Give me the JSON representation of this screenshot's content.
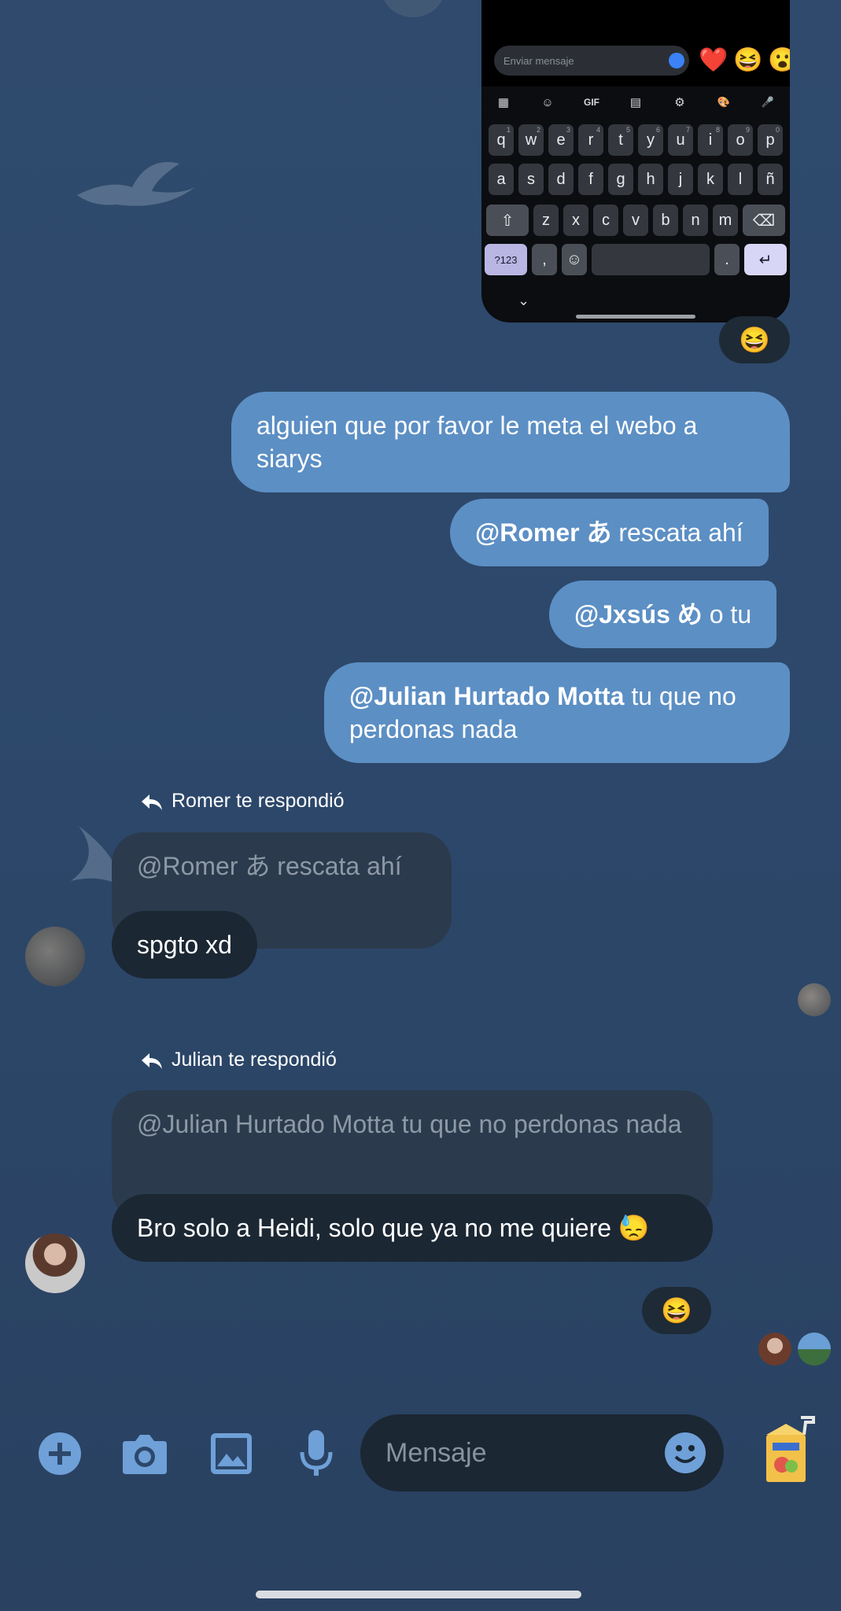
{
  "keyboard_screenshot": {
    "input_placeholder": "Enviar mensaje",
    "emojis": [
      "❤️",
      "😆",
      "😮"
    ],
    "tools": [
      "▦",
      "☺",
      "GIF",
      "▤",
      "⚙",
      "🎨",
      "🎤"
    ],
    "row1": [
      [
        "q",
        "1"
      ],
      [
        "w",
        "2"
      ],
      [
        "e",
        "3"
      ],
      [
        "r",
        "4"
      ],
      [
        "t",
        "5"
      ],
      [
        "y",
        "6"
      ],
      [
        "u",
        "7"
      ],
      [
        "i",
        "8"
      ],
      [
        "o",
        "9"
      ],
      [
        "p",
        "0"
      ]
    ],
    "row2": [
      "a",
      "s",
      "d",
      "f",
      "g",
      "h",
      "j",
      "k",
      "l",
      "ñ"
    ],
    "row3": [
      "z",
      "x",
      "c",
      "v",
      "b",
      "n",
      "m"
    ],
    "shift": "⇧",
    "backspace": "⌫",
    "num_key": "?123",
    "comma": ",",
    "emoji_key": "☺",
    "period": ".",
    "enter": "↵",
    "chevron": "⌄"
  },
  "reaction_top": "😆",
  "outgoing": [
    {
      "text": "alguien que por favor le meta el webo a siarys"
    },
    {
      "mention": "@Romer あ",
      "text": " rescata ahí"
    },
    {
      "mention": "@Jxsús め",
      "text": " o tu"
    },
    {
      "mention": "@Julian Hurtado Motta",
      "text": " tu que no perdonas nada"
    }
  ],
  "reply1": {
    "label": "Romer te respondió",
    "quoted": "@Romer あ rescata ahí",
    "message": "spgto xd"
  },
  "reply2": {
    "label": "Julian te respondió",
    "quoted": "@Julian Hurtado Motta tu que no perdonas nada",
    "message": "Bro solo a Heidi, solo que ya no me quiere 😓",
    "reaction": "😆"
  },
  "composer": {
    "placeholder": "Mensaje",
    "icons": [
      "add-icon",
      "camera-icon",
      "gallery-icon",
      "microphone-icon",
      "emoji-icon",
      "sticker-icon"
    ]
  },
  "colors": {
    "outgoing_bubble": "#5c8fc4",
    "incoming_bubble": "#1b2733",
    "quoted_bubble": "#2b3b4d",
    "icon_accent": "#6fa0d8"
  }
}
